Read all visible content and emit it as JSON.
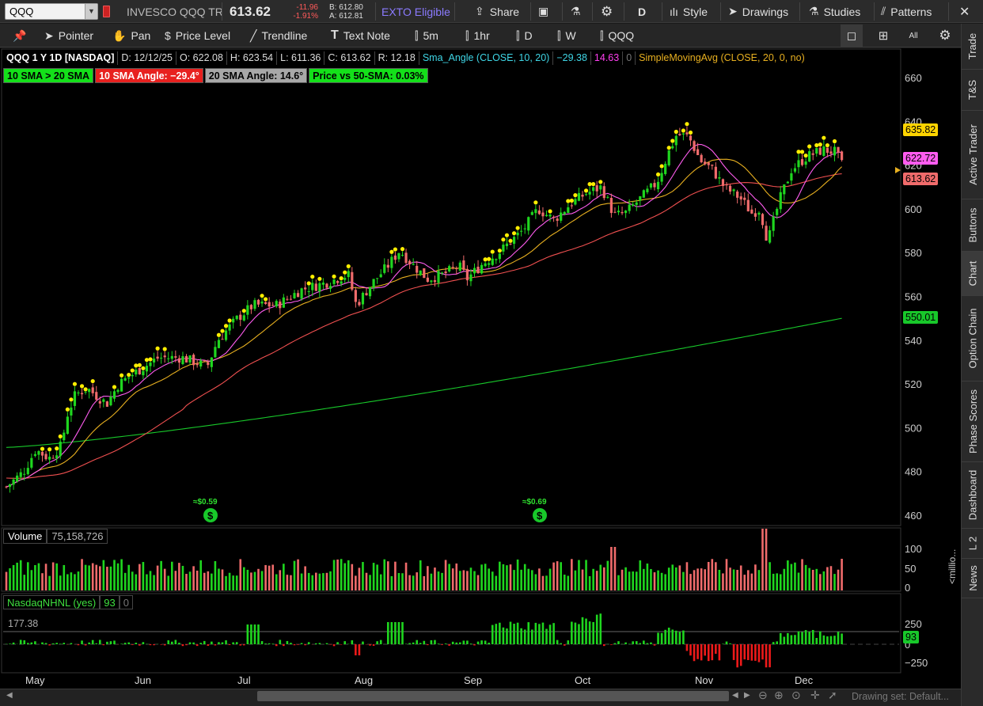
{
  "topbar": {
    "symbol": "QQQ",
    "description": "INVESCO QQQ TR",
    "last": "613.62",
    "change": "-11.96",
    "change_pct": "-1.91%",
    "bid": "B: 612.80",
    "ask": "A: 612.81",
    "exto": "EXTO Eligible",
    "share": "Share",
    "period": "D",
    "style": "Style",
    "drawings": "Drawings",
    "studies": "Studies",
    "patterns": "Patterns"
  },
  "toolbar": {
    "pointer": "Pointer",
    "pan": "Pan",
    "price_level": "Price Level",
    "trendline": "Trendline",
    "text_note": "Text Note",
    "tf_5m": "5m",
    "tf_1hr": "1hr",
    "tf_d": "D",
    "tf_w": "W",
    "tf_qqq": "QQQ"
  },
  "header": {
    "title": "QQQ 1 Y 1D [NASDAQ]",
    "date": "D: 12/12/25",
    "open": "O: 622.08",
    "high": "H: 623.54",
    "low": "L: 611.36",
    "close": "C: 613.62",
    "range": "R: 12.18",
    "study1": "Sma_Angle (CLOSE, 10, 20)",
    "study1_v1": "−29.38",
    "study1_v2": "14.63",
    "study1_v3": "0",
    "study2": "SimpleMovingAvg (CLOSE, 20, 0, no)"
  },
  "labels": [
    {
      "text": "10 SMA > 20 SMA",
      "color": "#14e01a"
    },
    {
      "text": "10 SMA Angle: −29.4°",
      "color": "#e8211f"
    },
    {
      "text": "20 SMA Angle: 14.6°",
      "color": "#a8a8a8"
    },
    {
      "text": "Price vs 50-SMA: 0.03%",
      "color": "#14e01a"
    }
  ],
  "price_axis": {
    "ticks": [
      "660",
      "640",
      "620",
      "600",
      "580",
      "560",
      "540",
      "520",
      "500",
      "480",
      "460"
    ],
    "tags": [
      {
        "value": "635.82",
        "color": "#ffd400"
      },
      {
        "value": "622.72",
        "color": "#ff5cf0"
      },
      {
        "value": "613.62",
        "color": "#f06b6b"
      },
      {
        "value": "550.01",
        "color": "#18c82a"
      }
    ]
  },
  "dividends": [
    {
      "text": "≈$0.59"
    },
    {
      "text": "≈$0.69"
    }
  ],
  "volume": {
    "title": "Volume",
    "value": "75,158,726",
    "ticks": [
      "100",
      "50",
      "0"
    ],
    "unit": "<millio..."
  },
  "nhnl": {
    "title": "NasdaqNHNL (yes)",
    "value": "93",
    "zero": "0",
    "ref": "177.38",
    "ticks": [
      "250",
      "0",
      "−250"
    ],
    "tag": "93"
  },
  "months": [
    "May",
    "Jun",
    "Jul",
    "Aug",
    "Sep",
    "Oct",
    "Nov",
    "Dec"
  ],
  "right_tabs": [
    "Trade",
    "T&S",
    "Active Trader",
    "Buttons",
    "Chart",
    "Option Chain",
    "Phase Scores",
    "Dashboard",
    "L 2",
    "News"
  ],
  "bottom": {
    "drawing_set": "Drawing set: Default..."
  },
  "colors": {
    "up": "#1fd61f",
    "down": "#f06b6b",
    "sma10": "#ff5cf0",
    "sma20": "#e8b020",
    "sma50": "#f05050",
    "sma200": "#18c82a",
    "dot": "#ffee00"
  },
  "chart_data": {
    "type": "candlestick",
    "title": "QQQ 1 Y 1D [NASDAQ]",
    "ylim": [
      455,
      668
    ],
    "series": [
      {
        "name": "SimpleMovingAvg (CLOSE, 20, 0, no)",
        "last": 622.72
      },
      {
        "name": "SMA 50",
        "last": 613.62
      },
      {
        "name": "SMA 200",
        "last": 550.01
      }
    ],
    "last_close": 613.62,
    "high_marker": 635.82
  }
}
